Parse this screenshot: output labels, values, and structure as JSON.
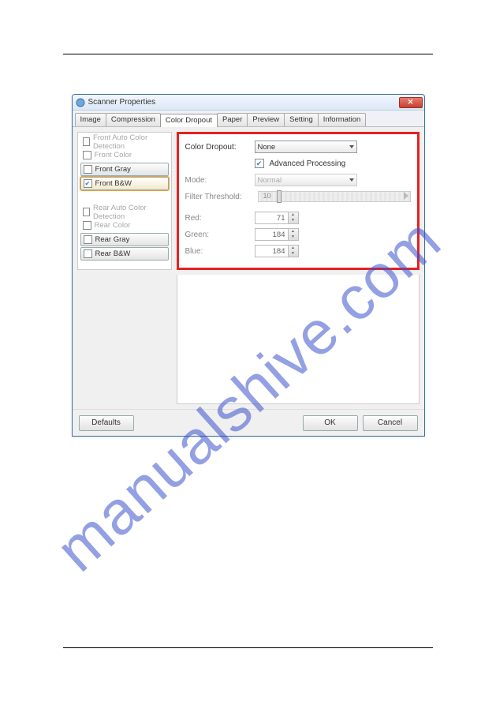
{
  "watermark": "manualshive.com",
  "window": {
    "title": "Scanner Properties"
  },
  "tabs": [
    "Image",
    "Compression",
    "Color Dropout",
    "Paper",
    "Preview",
    "Setting",
    "Information"
  ],
  "active_tab": 2,
  "sidebar_groups": [
    [
      {
        "label": "Front Auto Color Detection",
        "checked": false,
        "style": "plain",
        "dim": true
      },
      {
        "label": "Front Color",
        "checked": false,
        "style": "plain",
        "dim": true
      },
      {
        "label": "Front Gray",
        "checked": false,
        "style": "button",
        "dim": false
      },
      {
        "label": "Front B&W",
        "checked": true,
        "style": "button",
        "dim": false,
        "selected": true
      }
    ],
    [
      {
        "label": "Rear Auto Color Detection",
        "checked": false,
        "style": "plain",
        "dim": true
      },
      {
        "label": "Rear Color",
        "checked": false,
        "style": "plain",
        "dim": true
      },
      {
        "label": "Rear Gray",
        "checked": false,
        "style": "button",
        "dim": false
      },
      {
        "label": "Rear B&W",
        "checked": false,
        "style": "button",
        "dim": false
      }
    ]
  ],
  "panel": {
    "color_dropout": {
      "label": "Color Dropout:",
      "value": "None"
    },
    "advanced_processing": {
      "label": "Advanced Processing",
      "checked": true
    },
    "mode": {
      "label": "Mode:",
      "value": "Normal"
    },
    "filter_threshold": {
      "label": "Filter Threshold:",
      "value": "10"
    },
    "red": {
      "label": "Red:",
      "value": "71"
    },
    "green": {
      "label": "Green:",
      "value": "184"
    },
    "blue": {
      "label": "Blue:",
      "value": "184"
    }
  },
  "buttons": {
    "defaults": "Defaults",
    "ok": "OK",
    "cancel": "Cancel"
  }
}
